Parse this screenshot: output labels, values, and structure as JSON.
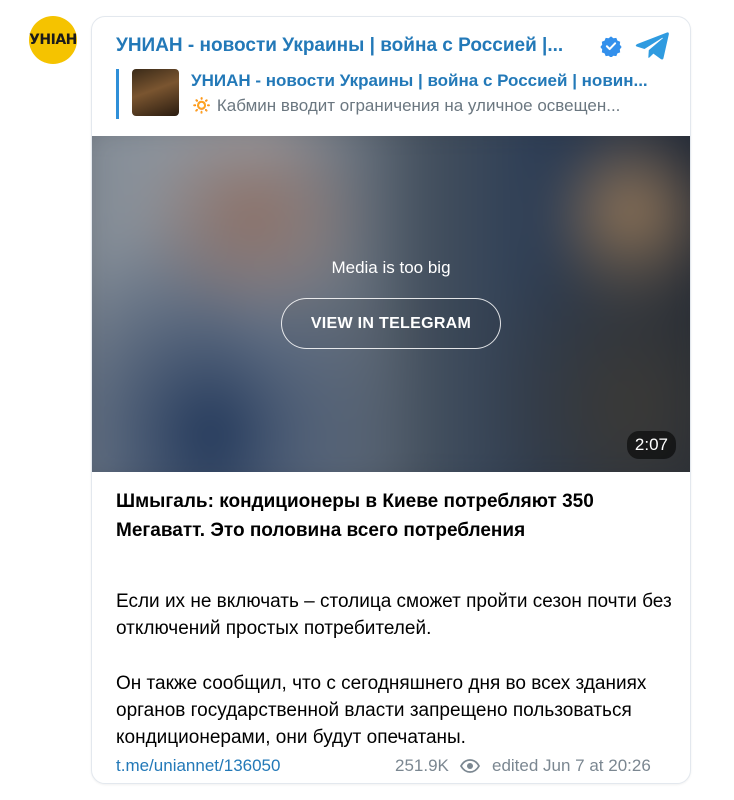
{
  "logo": {
    "text": "УНIAН"
  },
  "channel": {
    "title": "УНИАН - новости Украины | война с Россией |...",
    "verified": true,
    "icons": {
      "verified": "verified-badge-icon",
      "telegram": "telegram-logo-icon"
    }
  },
  "reply": {
    "name": "УНИАН - новости Украины | война с Россией | новин...",
    "text": "🔅 Кабмин вводит ограничения на уличное освещен..."
  },
  "media": {
    "message": "Media is too big",
    "button_label": "VIEW IN TELEGRAM",
    "duration": "2:07"
  },
  "post": {
    "title": "Шмыгаль: кондиционеры в Киеве потребляют 350 Мегаватт. Это половина всего потребления",
    "paragraph1": "Если их не включать – столица сможет пройти сезон почти без отключений простых потребителей.",
    "paragraph2": "Он также сообщил, что с сегодняшнего дня во всех зданиях органов государственной власти запрещено пользоваться кондиционерами, они будут опечатаны."
  },
  "footer": {
    "link": "t.me/uniannet/136050",
    "views": "251.9K",
    "edited": "edited  Jun 7 at 20:26"
  },
  "colors": {
    "link": "#2379b8",
    "logo_bg": "#f5c300",
    "muted": "#7b8791"
  }
}
